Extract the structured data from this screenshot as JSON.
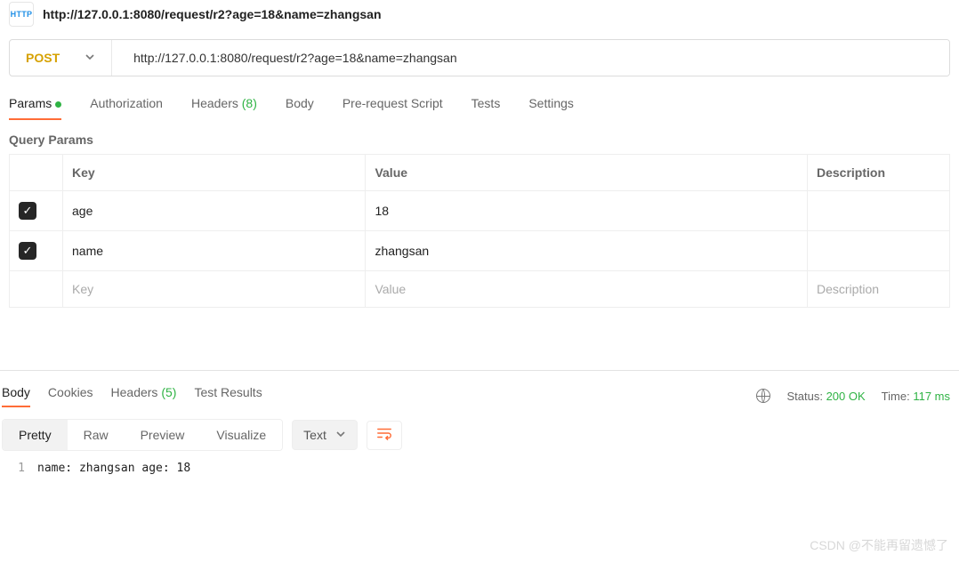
{
  "header": {
    "icon_label": "HTTP",
    "title": "http://127.0.0.1:8080/request/r2?age=18&name=zhangsan"
  },
  "request": {
    "method": "POST",
    "url": "http://127.0.0.1:8080/request/r2?age=18&name=zhangsan"
  },
  "tabs": {
    "params": "Params",
    "authorization": "Authorization",
    "headers": "Headers",
    "headers_count": "(8)",
    "body": "Body",
    "pre_request": "Pre-request Script",
    "tests": "Tests",
    "settings": "Settings"
  },
  "params_section": {
    "title": "Query Params",
    "columns": {
      "key": "Key",
      "value": "Value",
      "description": "Description"
    },
    "rows": [
      {
        "checked": true,
        "key": "age",
        "value": "18",
        "description": ""
      },
      {
        "checked": true,
        "key": "name",
        "value": "zhangsan",
        "description": ""
      }
    ],
    "placeholder": {
      "key": "Key",
      "value": "Value",
      "description": "Description"
    }
  },
  "response_tabs": {
    "body": "Body",
    "cookies": "Cookies",
    "headers": "Headers",
    "headers_count": "(5)",
    "test_results": "Test Results"
  },
  "response_meta": {
    "status_label": "Status:",
    "status_value": "200 OK",
    "time_label": "Time:",
    "time_value": "117 ms"
  },
  "toolbar": {
    "pretty": "Pretty",
    "raw": "Raw",
    "preview": "Preview",
    "visualize": "Visualize",
    "type": "Text"
  },
  "response_body": {
    "line_num": "1",
    "line": "name: zhangsan age: 18"
  },
  "watermark": "CSDN @不能再留遗憾了"
}
